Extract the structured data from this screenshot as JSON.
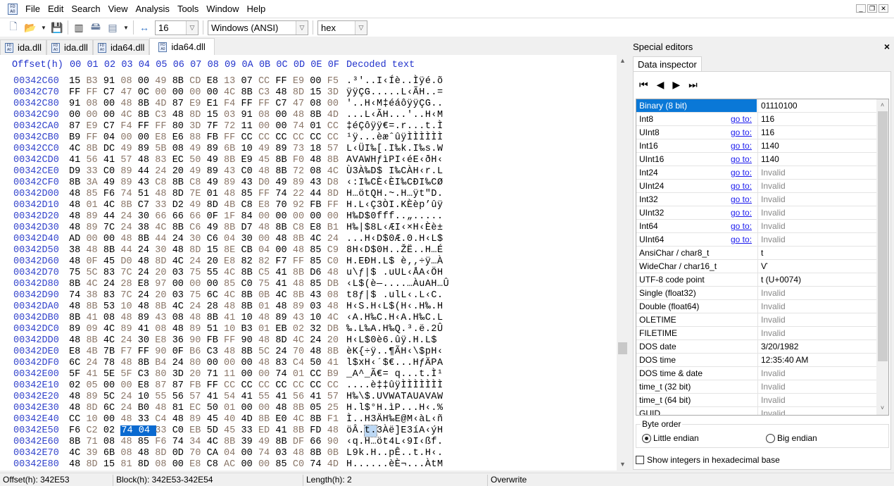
{
  "menu": [
    "File",
    "Edit",
    "Search",
    "View",
    "Analysis",
    "Tools",
    "Window",
    "Help"
  ],
  "toolbar": {
    "bytes_per_row": "16",
    "charset": "Windows (ANSI)",
    "base": "hex"
  },
  "tabs": [
    "ida.dll",
    "ida.dll",
    "ida64.dll",
    "ida64.dll"
  ],
  "hex": {
    "header_offset": "Offset(h)",
    "columns": [
      "00",
      "01",
      "02",
      "03",
      "04",
      "05",
      "06",
      "07",
      "08",
      "09",
      "0A",
      "0B",
      "0C",
      "0D",
      "0E",
      "0F"
    ],
    "header_text": "Decoded text",
    "selection": {
      "row": "00342E50",
      "cols": [
        3,
        4
      ]
    },
    "rows": [
      {
        "o": "00342C60",
        "b": "15 B3 91 08 00 49 8B CD E8 13 07 CC FF E9 00 F5",
        "t": ".³'..I‹Íè..Ìÿé.õ"
      },
      {
        "o": "00342C70",
        "b": "FF FF C7 47 0C 00 00 00 00 4C 8B C3 48 8D 15 3D",
        "t": "ÿÿÇG.....L‹ÃH..="
      },
      {
        "o": "00342C80",
        "b": "91 08 00 48 8B 4D 87 E9 E1 F4 FF FF C7 47 08 00",
        "t": "'..H‹M‡éáôÿÿÇG.."
      },
      {
        "o": "00342C90",
        "b": "00 00 00 4C 8B C3 48 8D 15 03 91 08 00 48 8B 4D",
        "t": "...L‹ÃH...'..H‹M"
      },
      {
        "o": "00342CA0",
        "b": "87 E9 C7 F4 FF FF 80 3D 7F 72 11 00 00 74 01 CC",
        "t": "‡éÇôÿÿ€=.r...t.Ì"
      },
      {
        "o": "00342CB0",
        "b": "B9 FF 04 00 00 E8 E6 88 FB FF CC CC CC CC CC CC",
        "t": "¹ÿ...èæˆûÿÌÌÌÌÌÌ"
      },
      {
        "o": "00342CC0",
        "b": "4C 8B DC 49 89 5B 08 49 89 6B 10 49 89 73 18 57",
        "t": "L‹ÜI‰[.I‰k.I‰s.W"
      },
      {
        "o": "00342CD0",
        "b": "41 56 41 57 48 83 EC 50 49 8B E9 45 8B F0 48 8B",
        "t": "AVAWHƒìPI‹éE‹ðH‹"
      },
      {
        "o": "00342CE0",
        "b": "D9 33 C0 89 44 24 20 49 89 43 C0 48 8B 72 08 4C",
        "t": "Ù3À‰D$ I‰CÀH‹r.L"
      },
      {
        "o": "00342CF0",
        "b": "8B 3A 49 89 43 C8 8B C8 49 89 43 D0 49 89 43 D8",
        "t": "‹:I‰CÈ‹ÈI‰CÐI‰CØ"
      },
      {
        "o": "00342D00",
        "b": "48 85 F6 74 51 48 8D 7E 01 48 85 FF 74 22 44 8D",
        "t": "H…ötQH.~.H…ÿt\"D."
      },
      {
        "o": "00342D10",
        "b": "48 01 4C 8B C7 33 D2 49 8D 4B C8 E8 70 92 FB FF",
        "t": "H.L‹Ç3ÒI.KÈèp’ûÿ"
      },
      {
        "o": "00342D20",
        "b": "48 89 44 24 30 66 66 66 0F 1F 84 00 00 00 00 00",
        "t": "H‰D$0fff..„....."
      },
      {
        "o": "00342D30",
        "b": "48 89 7C 24 38 4C 8B C6 49 8B D7 48 8B C8 E8 B1",
        "t": "H‰|$8L‹ÆI‹×H‹Èè±"
      },
      {
        "o": "00342D40",
        "b": "AD 00 00 48 8B 44 24 30 C6 04 30 00 48 8B 4C 24",
        "t": "...H‹D$0Æ.0.H‹L$"
      },
      {
        "o": "00342D50",
        "b": "38 48 8B 44 24 30 48 8D 15 8E CB 04 00 48 85 C9",
        "t": "8H‹D$0H..ŽË..H…É"
      },
      {
        "o": "00342D60",
        "b": "48 0F 45 D0 48 8D 4C 24 20 E8 82 82 F7 FF 85 C0",
        "t": "H.EÐH.L$ è‚‚÷ÿ…À"
      },
      {
        "o": "00342D70",
        "b": "75 5C 83 7C 24 20 03 75 55 4C 8B C5 41 8B D6 48",
        "t": "u\\ƒ|$ .uUL‹ÅA‹ÖH"
      },
      {
        "o": "00342D80",
        "b": "8B 4C 24 28 E8 97 00 00 00 85 C0 75 41 48 85 DB",
        "t": "‹L$(è—....…ÀuAH…Û"
      },
      {
        "o": "00342D90",
        "b": "74 38 83 7C 24 20 03 75 6C 4C 8B 0B 4C 8B 43 08",
        "t": "t8ƒ|$ .ulL‹.L‹C."
      },
      {
        "o": "00342DA0",
        "b": "48 8B 53 10 48 8B 4C 24 28 48 8B 01 48 89 03 48",
        "t": "H‹S.H‹L$(H‹.H‰.H"
      },
      {
        "o": "00342DB0",
        "b": "8B 41 08 48 89 43 08 48 8B 41 10 48 89 43 10 4C",
        "t": "‹A.H‰C.H‹A.H‰C.L"
      },
      {
        "o": "00342DC0",
        "b": "89 09 4C 89 41 08 48 89 51 10 B3 01 EB 02 32 DB",
        "t": "‰.L‰A.H‰Q.³.ë.2Û"
      },
      {
        "o": "00342DD0",
        "b": "48 8B 4C 24 30 E8 36 90 FB FF 90 48 8D 4C 24 20",
        "t": "H‹L$0è6.ûÿ.H.L$ "
      },
      {
        "o": "00342DE0",
        "b": "E8 4B 7B F7 FF 90 0F B6 C3 48 8B 5C 24 70 48 8B",
        "t": "èK{÷ÿ..¶ÃH‹\\$pH‹"
      },
      {
        "o": "00342DF0",
        "b": "6C 24 78 48 8B B4 24 80 00 00 00 48 83 C4 50 41",
        "t": "l$xH‹´$€...HƒÄPA"
      },
      {
        "o": "00342E00",
        "b": "5F 41 5E 5F C3 80 3D 20 71 11 00 00 74 01 CC B9",
        "t": "_A^_Ã€= q...t.Ì¹"
      },
      {
        "o": "00342E10",
        "b": "02 05 00 00 E8 87 87 FB FF CC CC CC CC CC CC CC",
        "t": "....è‡‡ûÿÌÌÌÌÌÌÌ"
      },
      {
        "o": "00342E20",
        "b": "48 89 5C 24 10 55 56 57 41 54 41 55 41 56 41 57",
        "t": "H‰\\$.UVWATAUAVAW"
      },
      {
        "o": "00342E30",
        "b": "48 8D 6C 24 B0 48 81 EC 50 01 00 00 48 8B 05 25",
        "t": "H.l$°H.ìP...H‹.%"
      },
      {
        "o": "00342E40",
        "b": "CC 10 00 48 33 C4 48 89 45 40 4D 8B E0 4C 8B F1",
        "t": "Ì..H3ÄH‰E@M‹àL‹ñ"
      },
      {
        "o": "00342E50",
        "b": "F6 C2 02 74 04 33 C0 EB 5D 45 33 ED 41 8B FD 48",
        "t": "öÂ.t.3Àë]E3íA‹ýH"
      },
      {
        "o": "00342E60",
        "b": "8B 71 08 48 85 F6 74 34 4C 8B 39 49 8B DF 66 90",
        "t": "‹q.H…öt4L‹9I‹ßf."
      },
      {
        "o": "00342E70",
        "b": "4C 39 6B 08 48 8D 0D 70 CA 04 00 74 03 48 8B 0B",
        "t": "L9k.H..pÊ..t.H‹."
      },
      {
        "o": "00342E80",
        "b": "48 8D 15 81 8D 08 00 E8 C8 AC 00 00 85 C0 74 4D",
        "t": "H......èÈ¬...ÀtM"
      }
    ]
  },
  "panel": {
    "title": "Special editors",
    "tab": "Data inspector",
    "goto_label": "go to:",
    "rows": [
      {
        "n": "Binary (8 bit)",
        "v": "01110100",
        "g": false,
        "inv": false
      },
      {
        "n": "Int8",
        "v": "116",
        "g": true,
        "inv": false
      },
      {
        "n": "UInt8",
        "v": "116",
        "g": true,
        "inv": false
      },
      {
        "n": "Int16",
        "v": "1140",
        "g": true,
        "inv": false
      },
      {
        "n": "UInt16",
        "v": "1140",
        "g": true,
        "inv": false
      },
      {
        "n": "Int24",
        "v": "Invalid",
        "g": true,
        "inv": true
      },
      {
        "n": "UInt24",
        "v": "Invalid",
        "g": true,
        "inv": true
      },
      {
        "n": "Int32",
        "v": "Invalid",
        "g": true,
        "inv": true
      },
      {
        "n": "UInt32",
        "v": "Invalid",
        "g": true,
        "inv": true
      },
      {
        "n": "Int64",
        "v": "Invalid",
        "g": true,
        "inv": true
      },
      {
        "n": "UInt64",
        "v": "Invalid",
        "g": true,
        "inv": true
      },
      {
        "n": "AnsiChar / char8_t",
        "v": "t",
        "g": false,
        "inv": false
      },
      {
        "n": "WideChar / char16_t",
        "v": "Ѵ",
        "g": false,
        "inv": false
      },
      {
        "n": "UTF-8 code point",
        "v": "t (U+0074)",
        "g": false,
        "inv": false
      },
      {
        "n": "Single (float32)",
        "v": "Invalid",
        "g": false,
        "inv": true
      },
      {
        "n": "Double (float64)",
        "v": "Invalid",
        "g": false,
        "inv": true
      },
      {
        "n": "OLETIME",
        "v": "Invalid",
        "g": false,
        "inv": true
      },
      {
        "n": "FILETIME",
        "v": "Invalid",
        "g": false,
        "inv": true
      },
      {
        "n": "DOS date",
        "v": "3/20/1982",
        "g": false,
        "inv": false
      },
      {
        "n": "DOS time",
        "v": "12:35:40 AM",
        "g": false,
        "inv": false
      },
      {
        "n": "DOS time & date",
        "v": "Invalid",
        "g": false,
        "inv": true
      },
      {
        "n": "time_t (32 bit)",
        "v": "Invalid",
        "g": false,
        "inv": true
      },
      {
        "n": "time_t (64 bit)",
        "v": "Invalid",
        "g": false,
        "inv": true
      },
      {
        "n": "GUID",
        "v": "Invalid",
        "g": false,
        "inv": true
      }
    ],
    "byte_order_label": "Byte order",
    "little_endian": "Little endian",
    "big_endian": "Big endian",
    "hex_checkbox": "Show integers in hexadecimal base"
  },
  "status": {
    "offset": "Offset(h): 342E53",
    "block": "Block(h): 342E53-342E54",
    "length": "Length(h): 2",
    "mode": "Overwrite"
  }
}
